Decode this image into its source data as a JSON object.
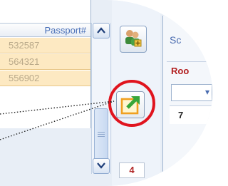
{
  "grid": {
    "header": "Passport#",
    "rows": [
      "532587",
      "564321",
      "556902"
    ]
  },
  "toolbar": {
    "users_icon": "users-add-icon",
    "export_icon": "export-icon",
    "counter": "4"
  },
  "right_panel": {
    "sc_label": "Sc",
    "room_label": "Roo",
    "room_value": "7"
  },
  "colors": {
    "highlight": "#e0141e",
    "row_fill": "#fde9c2",
    "header_text": "#4a70b8"
  }
}
